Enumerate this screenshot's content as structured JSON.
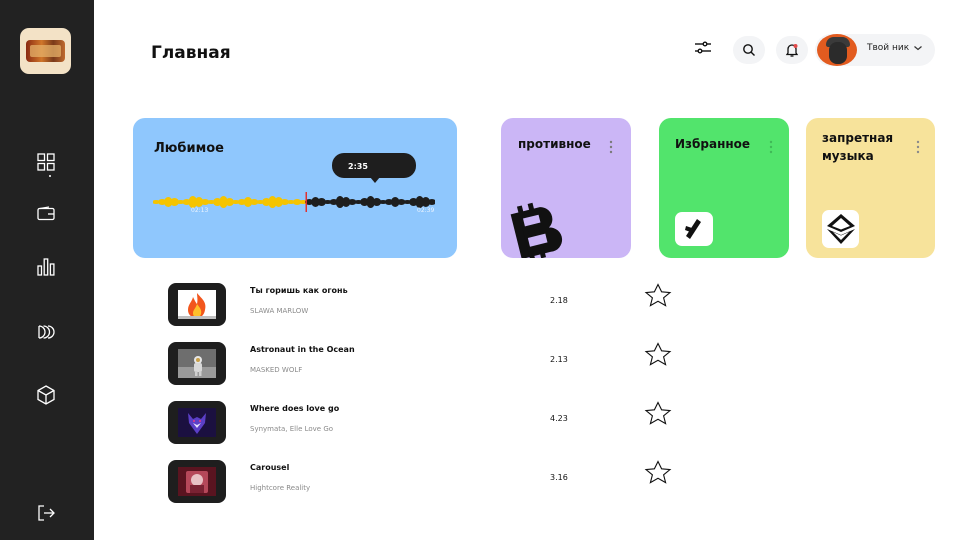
{
  "page": {
    "title": "Главная"
  },
  "sidebar": {
    "items": [
      {
        "icon": "dashboard-grid-icon"
      },
      {
        "icon": "wallet-icon"
      },
      {
        "icon": "bar-chart-icon"
      },
      {
        "icon": "stacked-circles-icon"
      },
      {
        "icon": "cube-icon"
      },
      {
        "icon": "logout-icon"
      }
    ]
  },
  "header": {
    "user_name": "Твой ник",
    "icons": [
      "filter-sliders-icon",
      "search-icon",
      "bell-icon",
      "chevron-down-icon"
    ],
    "notification_dot_color": "#e24a4a"
  },
  "cards": {
    "favorite": {
      "title": "Любимое",
      "current_time": "2:35",
      "time_start": "02:13",
      "time_end": "02:39",
      "color": "#8fc7fd",
      "wave_played_color": "#f5c400",
      "wave_rest_color": "#1e1e1e",
      "progress": 0.54
    },
    "vile": {
      "title": "противное",
      "icon": "bitcoin-icon",
      "color": "#cbb6f6"
    },
    "chosen": {
      "title": "Избранное",
      "icon": "coin-logo-icon",
      "color": "#52e46c"
    },
    "banned": {
      "title_line1": "запретная",
      "title_line2": "музыка",
      "icon": "ethereum-icon",
      "color": "#f7e39b"
    }
  },
  "tracks": [
    {
      "name": "Ты горишь как огонь",
      "artist": "SLAWA MARLOW",
      "duration": "2.18",
      "cover": "fire"
    },
    {
      "name": "Astronaut in the Ocean",
      "artist": "MASKED WOLF",
      "duration": "2.13",
      "cover": "astronaut"
    },
    {
      "name": "Where does love go",
      "artist": "Synymata, Elle Love Go",
      "duration": "4.23",
      "cover": "wolf"
    },
    {
      "name": "Carousel",
      "artist": "Hightcore Reality",
      "duration": "3.16",
      "cover": "carousel"
    }
  ]
}
